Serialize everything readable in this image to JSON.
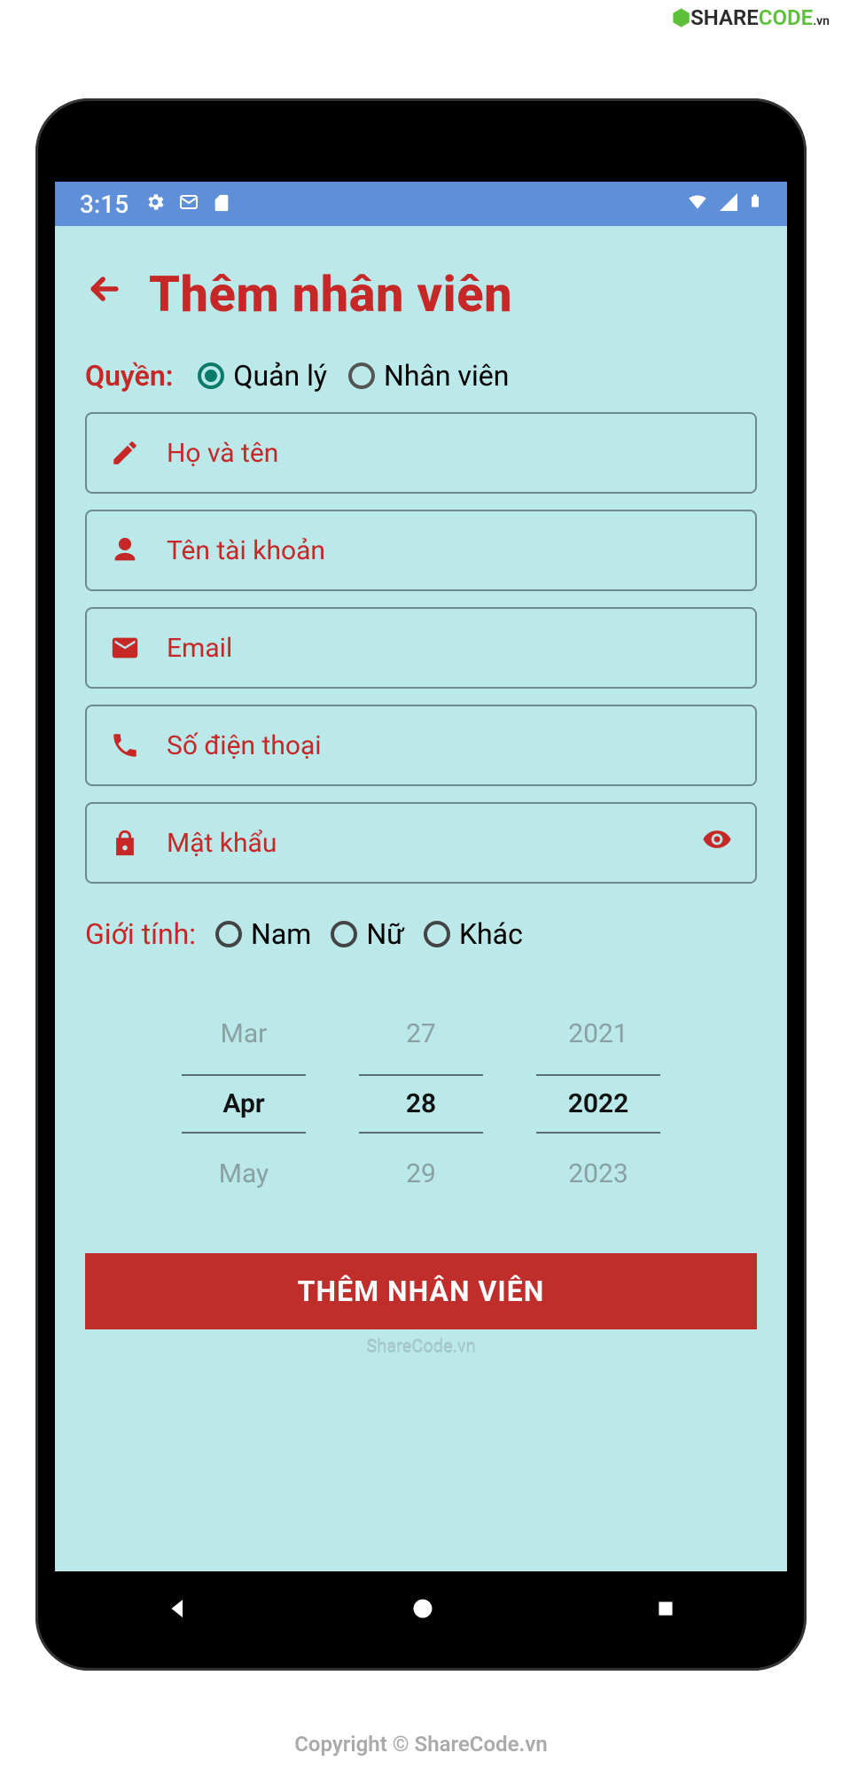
{
  "watermark": {
    "top": "SHARECODE.vn",
    "bottom": "Copyright © ShareCode.vn",
    "inline": "ShareCode.vn"
  },
  "statusbar": {
    "time": "3:15"
  },
  "header": {
    "title": "Thêm nhân viên"
  },
  "role": {
    "label": "Quyền:",
    "options": [
      {
        "label": "Quản lý",
        "selected": true
      },
      {
        "label": "Nhân viên",
        "selected": false
      }
    ]
  },
  "fields": {
    "fullname": {
      "placeholder": "Họ và tên"
    },
    "username": {
      "placeholder": "Tên tài khoản"
    },
    "email": {
      "placeholder": "Email"
    },
    "phone": {
      "placeholder": "Số điện thoại"
    },
    "password": {
      "placeholder": "Mật khẩu"
    }
  },
  "gender": {
    "label": "Giới tính:",
    "options": [
      {
        "label": "Nam"
      },
      {
        "label": "Nữ"
      },
      {
        "label": "Khác"
      }
    ]
  },
  "datepicker": {
    "month": {
      "prev": "Mar",
      "current": "Apr",
      "next": "May"
    },
    "day": {
      "prev": "27",
      "current": "28",
      "next": "29"
    },
    "year": {
      "prev": "2021",
      "current": "2022",
      "next": "2023"
    }
  },
  "submit": {
    "label": "THÊM NHÂN VIÊN"
  }
}
